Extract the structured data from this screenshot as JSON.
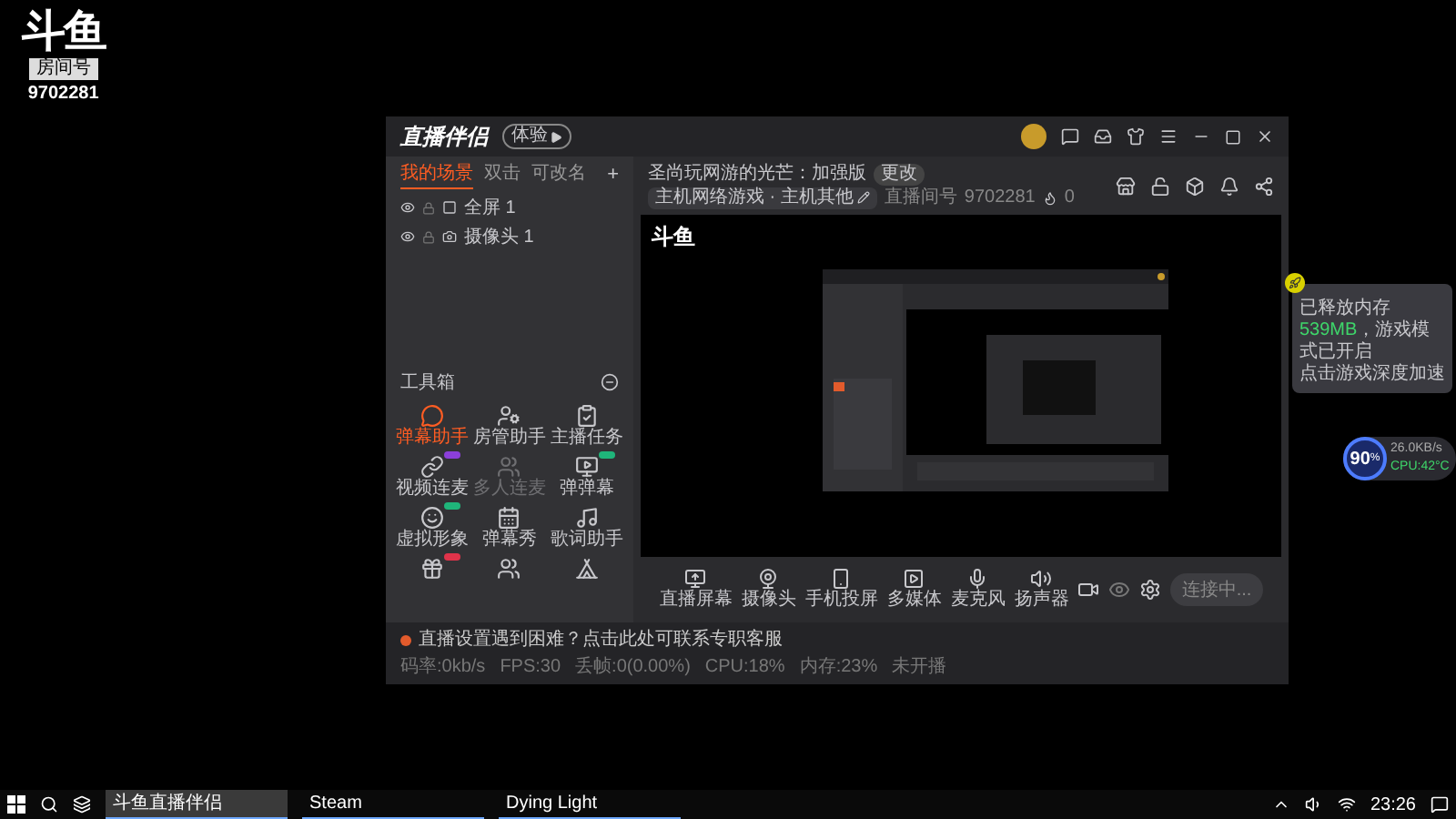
{
  "overlay_logo": {
    "logo": "斗鱼",
    "label": "房间号",
    "room": "9702281"
  },
  "app": {
    "title_bar": {
      "logo": "直播伴侣",
      "badge": "体验"
    },
    "scene_tabs": [
      {
        "label": "我的场景",
        "selected": true
      },
      {
        "label": "双击",
        "selected": false
      },
      {
        "label": "可改名",
        "selected": false
      }
    ],
    "add_scene": "+",
    "sources": [
      {
        "name": "全屏 1",
        "kind": "screen"
      },
      {
        "name": "摄像头 1",
        "kind": "camera"
      }
    ],
    "toolbox": {
      "title": "工具箱",
      "tools": [
        {
          "label": "弹幕助手",
          "kind": "chat",
          "active": true,
          "disabled": false
        },
        {
          "label": "房管助手",
          "kind": "user",
          "active": false,
          "disabled": false
        },
        {
          "label": "主播任务",
          "kind": "task",
          "active": false,
          "disabled": false
        },
        {
          "label": "视频连麦",
          "kind": "link",
          "active": false,
          "disabled": false,
          "color": "#8b3fd9"
        },
        {
          "label": "多人连麦",
          "kind": "users",
          "active": false,
          "disabled": true
        },
        {
          "label": "弹弹幕",
          "kind": "screen",
          "active": false,
          "disabled": false,
          "color": "#1fb57a"
        },
        {
          "label": "虚拟形象",
          "kind": "avatar",
          "active": false,
          "disabled": false,
          "color": "#1fb57a"
        },
        {
          "label": "弹幕秀",
          "kind": "calendar",
          "active": false,
          "disabled": false
        },
        {
          "label": "歌词助手",
          "kind": "music",
          "active": false,
          "disabled": false
        },
        {
          "kind": "gift",
          "active": false,
          "disabled": false,
          "color": "#e0334a"
        },
        {
          "kind": "users",
          "active": false,
          "disabled": false
        },
        {
          "kind": "tent",
          "active": false,
          "disabled": false
        }
      ]
    },
    "stream": {
      "title": "圣尚玩网游的光芒：加强版",
      "edit": "更改",
      "category": "主机网络游戏 · 主机其他",
      "room_label": "直播间号",
      "room": "9702281",
      "heat": "0"
    },
    "controls": [
      {
        "label": "直播屏幕",
        "kind": "screen"
      },
      {
        "label": "摄像头",
        "kind": "camera"
      },
      {
        "label": "手机投屏",
        "kind": "phone"
      },
      {
        "label": "多媒体",
        "kind": "media"
      },
      {
        "label": "麦克风",
        "kind": "mic"
      },
      {
        "label": "扬声器",
        "kind": "speaker"
      }
    ],
    "connect_button": "连接中...",
    "status": {
      "help": "直播设置遇到困难？点击此处可联系专职客服",
      "stats": [
        "码率:0kb/s",
        "FPS:30",
        "丢帧:0(0.00%)",
        "CPU:18%",
        "内存:23%"
      ],
      "live_state": "未开播"
    }
  },
  "preview_logo": "斗鱼",
  "widget": {
    "before": "已释放内存",
    "value": "539MB",
    "after": "，游戏模式已开启",
    "action": "点击游戏深度加速",
    "score": "90",
    "unit": "%",
    "speed": "26.0KB/s",
    "temp": "CPU:42°C"
  },
  "taskbar": {
    "apps": [
      {
        "label": "斗鱼直播伴侣",
        "selected": true
      },
      {
        "label": "Steam",
        "selected": false
      },
      {
        "label": "Dying Light",
        "selected": false
      }
    ],
    "time": "23:26"
  }
}
